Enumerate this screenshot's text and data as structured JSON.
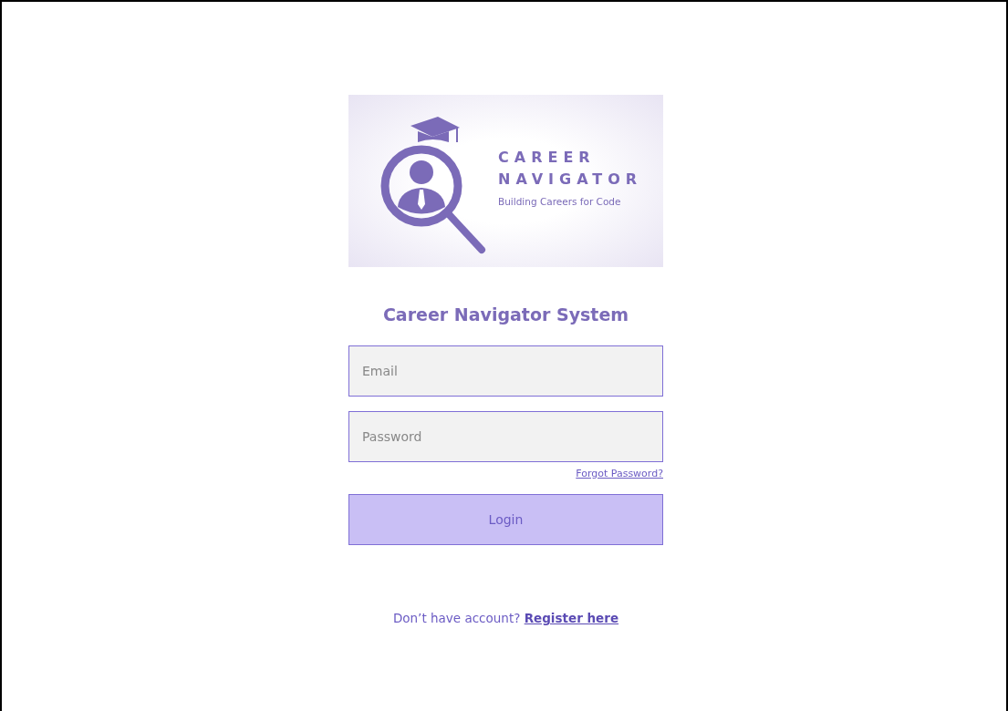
{
  "logo": {
    "line_1": "CAREER",
    "line_2": "NAVIGATOR",
    "tagline": "Building Careers for Code"
  },
  "title": "Career Navigator System",
  "fields": [
    {
      "placeholder": "Email"
    },
    {
      "placeholder": "Password"
    }
  ],
  "forgot_link": "Forgot Password?",
  "login_button": "Login",
  "register": {
    "prompt": "Don’t have account?",
    "link": "Register here"
  }
}
